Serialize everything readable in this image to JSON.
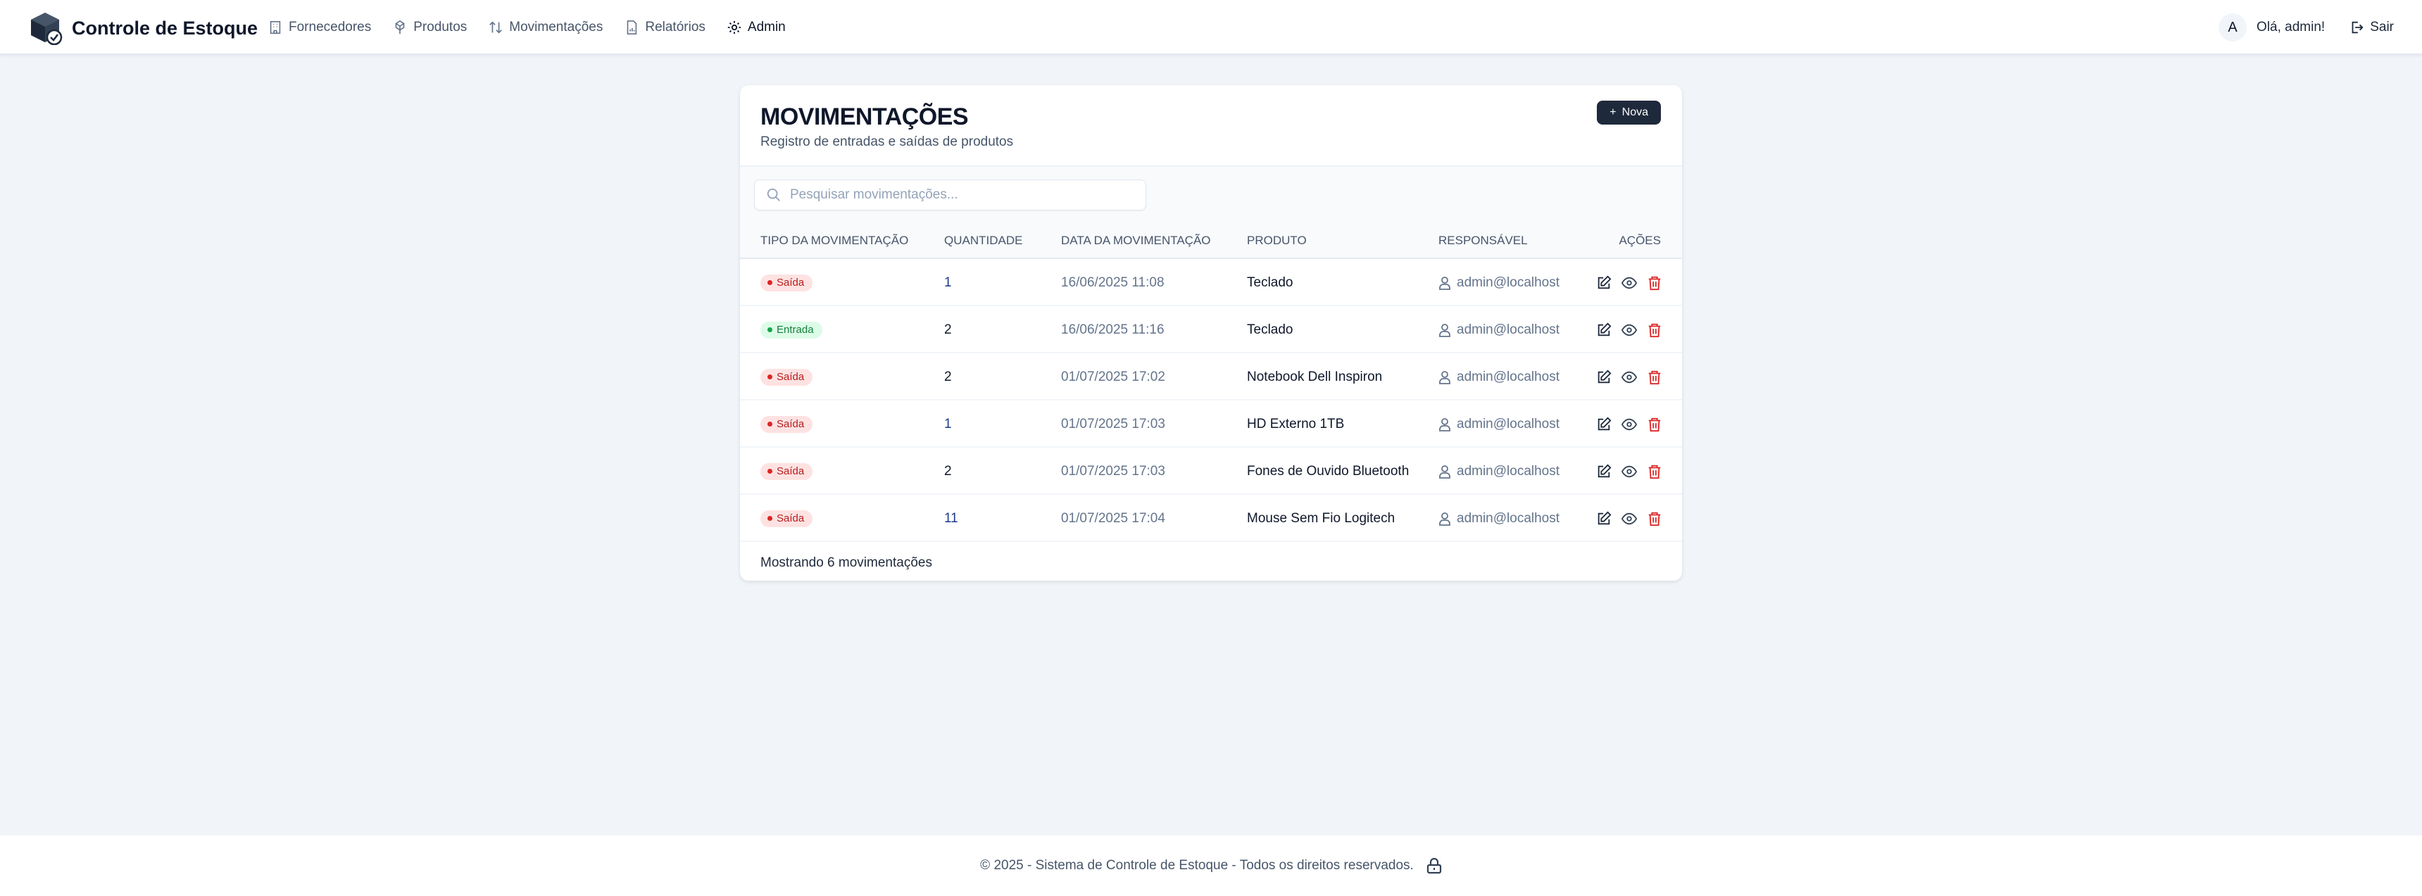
{
  "app": {
    "brand": "Controle de Estoque"
  },
  "nav": [
    {
      "label": "Fornecedores",
      "icon": "building-icon"
    },
    {
      "label": "Produtos",
      "icon": "package-icon"
    },
    {
      "label": "Movimentações",
      "icon": "arrows-up-down-icon"
    },
    {
      "label": "Relatórios",
      "icon": "report-icon"
    },
    {
      "label": "Admin",
      "icon": "gear-icon",
      "active": true
    }
  ],
  "user": {
    "initial": "A",
    "greeting": "Olá, admin!",
    "logout": "Sair"
  },
  "page": {
    "title": "MOVIMENTAÇÕES",
    "subtitle": "Registro de entradas e saídas de produtos",
    "new_button": "Nova"
  },
  "search": {
    "placeholder": "Pesquisar movimentações...",
    "value": ""
  },
  "table": {
    "columns": [
      "Tipo da Movimentação",
      "Quantidade",
      "Data da Movimentação",
      "Produto",
      "Responsável",
      "Ações"
    ],
    "rows": [
      {
        "tipo": "Saída",
        "quantidade": "1",
        "data": "16/06/2025 11:08",
        "produto": "Teclado",
        "responsavel": "admin@localhost"
      },
      {
        "tipo": "Entrada",
        "quantidade": "2",
        "data": "16/06/2025 11:16",
        "produto": "Teclado",
        "responsavel": "admin@localhost"
      },
      {
        "tipo": "Saída",
        "quantidade": "2",
        "data": "01/07/2025 17:02",
        "produto": "Notebook Dell Inspiron",
        "responsavel": "admin@localhost"
      },
      {
        "tipo": "Saída",
        "quantidade": "1",
        "data": "01/07/2025 17:03",
        "produto": "HD Externo 1TB",
        "responsavel": "admin@localhost"
      },
      {
        "tipo": "Saída",
        "quantidade": "2",
        "data": "01/07/2025 17:03",
        "produto": "Fones de Ouvido Bluetooth",
        "responsavel": "admin@localhost"
      },
      {
        "tipo": "Saída",
        "quantidade": "11",
        "data": "01/07/2025 17:04",
        "produto": "Mouse Sem Fio Logitech",
        "responsavel": "admin@localhost"
      }
    ],
    "count_text": "Mostrando 6 movimentações"
  },
  "footer": {
    "text": "© 2025 - Sistema de Controle de Estoque - Todos os direitos reservados."
  },
  "colors": {
    "primary": "#1e293b",
    "saida": "#dc2626",
    "entrada": "#16a34a",
    "background": "#f1f5f9"
  }
}
